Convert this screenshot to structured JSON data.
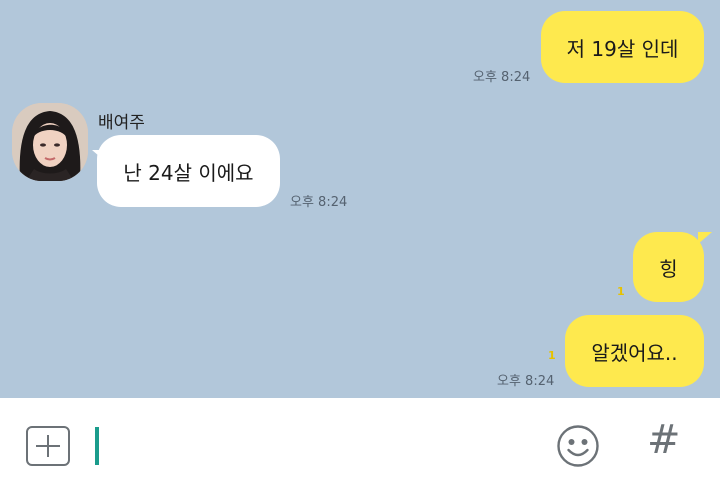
{
  "chat": {
    "messages": [
      {
        "side": "me",
        "text": "저 19살 인데",
        "time": "오후 8:24",
        "unread": ""
      },
      {
        "side": "other",
        "sender": "배여주",
        "text": "난 24살 이에요",
        "time": "오후 8:24"
      },
      {
        "side": "me",
        "text": "힝",
        "time": "",
        "unread": "1"
      },
      {
        "side": "me",
        "text": "알겠어요..",
        "time": "오후 8:24",
        "unread": "1"
      }
    ]
  },
  "input": {
    "placeholder": "",
    "value": ""
  },
  "icons": {
    "attach": "plus-square-icon",
    "emoticon": "smiley-icon",
    "hashtag": "hash-icon"
  },
  "colors": {
    "chat_background": "#b2c7da",
    "my_bubble": "#fee94e",
    "their_bubble": "#ffffff",
    "caret": "#1a9c8c"
  }
}
